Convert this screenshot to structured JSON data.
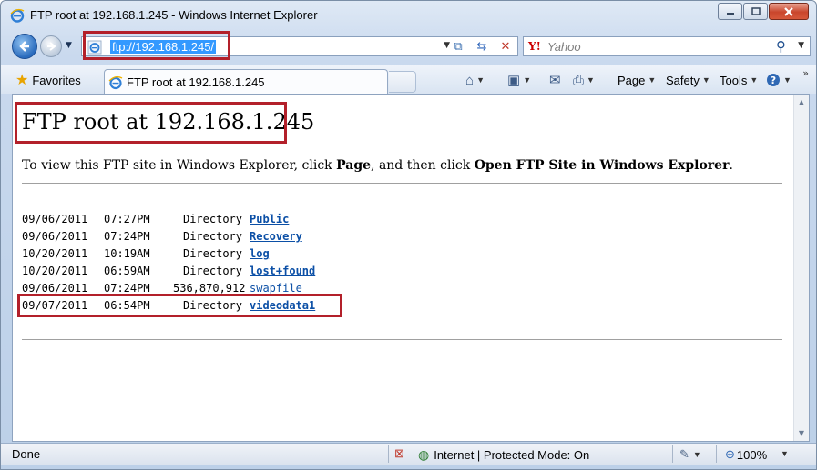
{
  "window": {
    "title": "FTP root at 192.168.1.245 - Windows Internet Explorer"
  },
  "address_bar": {
    "url": "ftp://192.168.1.245/"
  },
  "search": {
    "placeholder": "Yahoo"
  },
  "favorites_bar": {
    "favorites_label": "Favorites",
    "tab_label": "FTP root at 192.168.1.245"
  },
  "command_bar": {
    "page_label": "Page",
    "safety_label": "Safety",
    "tools_label": "Tools"
  },
  "content": {
    "title": "FTP root at 192.168.1.245",
    "instruction_pre": "To view this FTP site in Windows Explorer, click ",
    "instruction_page": "Page",
    "instruction_mid": ", and then click ",
    "instruction_open": "Open FTP Site in Windows Explorer",
    "instruction_end": ".",
    "entries": [
      {
        "date": "09/06/2011",
        "time": "07:27PM",
        "size": "Directory",
        "name": "Public"
      },
      {
        "date": "09/06/2011",
        "time": "07:24PM",
        "size": "Directory",
        "name": "Recovery"
      },
      {
        "date": "10/20/2011",
        "time": "10:19AM",
        "size": "Directory",
        "name": "log"
      },
      {
        "date": "10/20/2011",
        "time": "06:59AM",
        "size": "Directory",
        "name": "lost+found"
      },
      {
        "date": "09/06/2011",
        "time": "07:24PM",
        "size": "536,870,912",
        "name": "swapfile"
      },
      {
        "date": "09/07/2011",
        "time": "06:54PM",
        "size": "Directory",
        "name": "videodata1"
      }
    ]
  },
  "status_bar": {
    "status": "Done",
    "zone": "Internet | Protected Mode: On",
    "zoom": "100%"
  },
  "colors": {
    "highlight_box": "#b3202a",
    "link": "#0b4fa6",
    "url_selection": "#3399ff"
  },
  "icons": [
    "ie-icon",
    "back-icon",
    "forward-icon",
    "compat-view-icon",
    "refresh-icon",
    "stop-icon",
    "yahoo-icon",
    "search-icon",
    "favorites-star-icon",
    "home-icon",
    "feeds-icon",
    "mail-icon",
    "print-icon",
    "help-icon",
    "popup-blocked-icon",
    "globe-icon",
    "security-icon",
    "zoom-icon"
  ]
}
